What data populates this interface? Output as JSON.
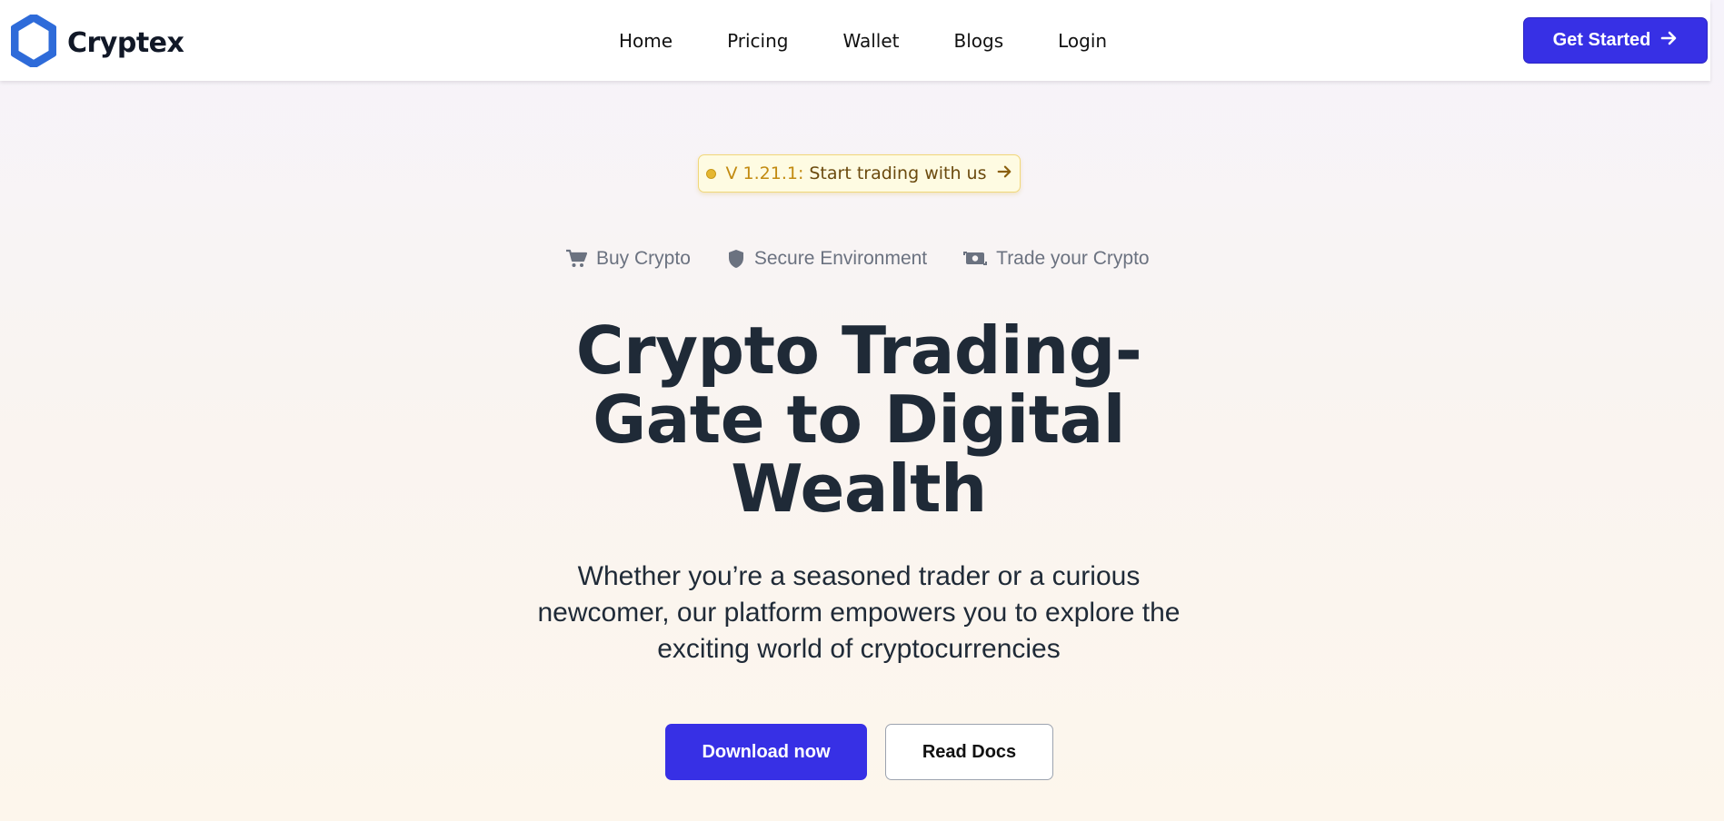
{
  "brand": {
    "name": "Cryptex",
    "logo_icon": "hexagon-logo-icon",
    "color": "#2e6bd9"
  },
  "nav": {
    "items": [
      {
        "label": "Home"
      },
      {
        "label": "Pricing"
      },
      {
        "label": "Wallet"
      },
      {
        "label": "Blogs"
      },
      {
        "label": "Login"
      }
    ],
    "cta_label": "Get Started",
    "cta_icon": "arrow-right-icon"
  },
  "badge": {
    "version": "V 1.21.1:",
    "message": "Start trading with us",
    "icon": "arrow-right-icon"
  },
  "features": [
    {
      "label": "Buy Crypto",
      "icon": "cart-icon"
    },
    {
      "label": "Secure Environment",
      "icon": "shield-icon"
    },
    {
      "label": "Trade your Crypto",
      "icon": "money-exchange-icon"
    }
  ],
  "hero": {
    "headline_line1": "Crypto Trading-",
    "headline_line2": "Gate to Digital",
    "headline_line3": "Wealth",
    "subtext_line1": "Whether you’re a seasoned trader or a curious",
    "subtext_line2": "newcomer, our platform empowers you to explore the",
    "subtext_line3": "exciting world of cryptocurrencies",
    "primary_button": "Download now",
    "secondary_button": "Read Docs"
  },
  "colors": {
    "accent": "#3730e5",
    "headline": "#1f2a37",
    "muted": "#6b7280",
    "badge_bg": "#fefbe2"
  }
}
